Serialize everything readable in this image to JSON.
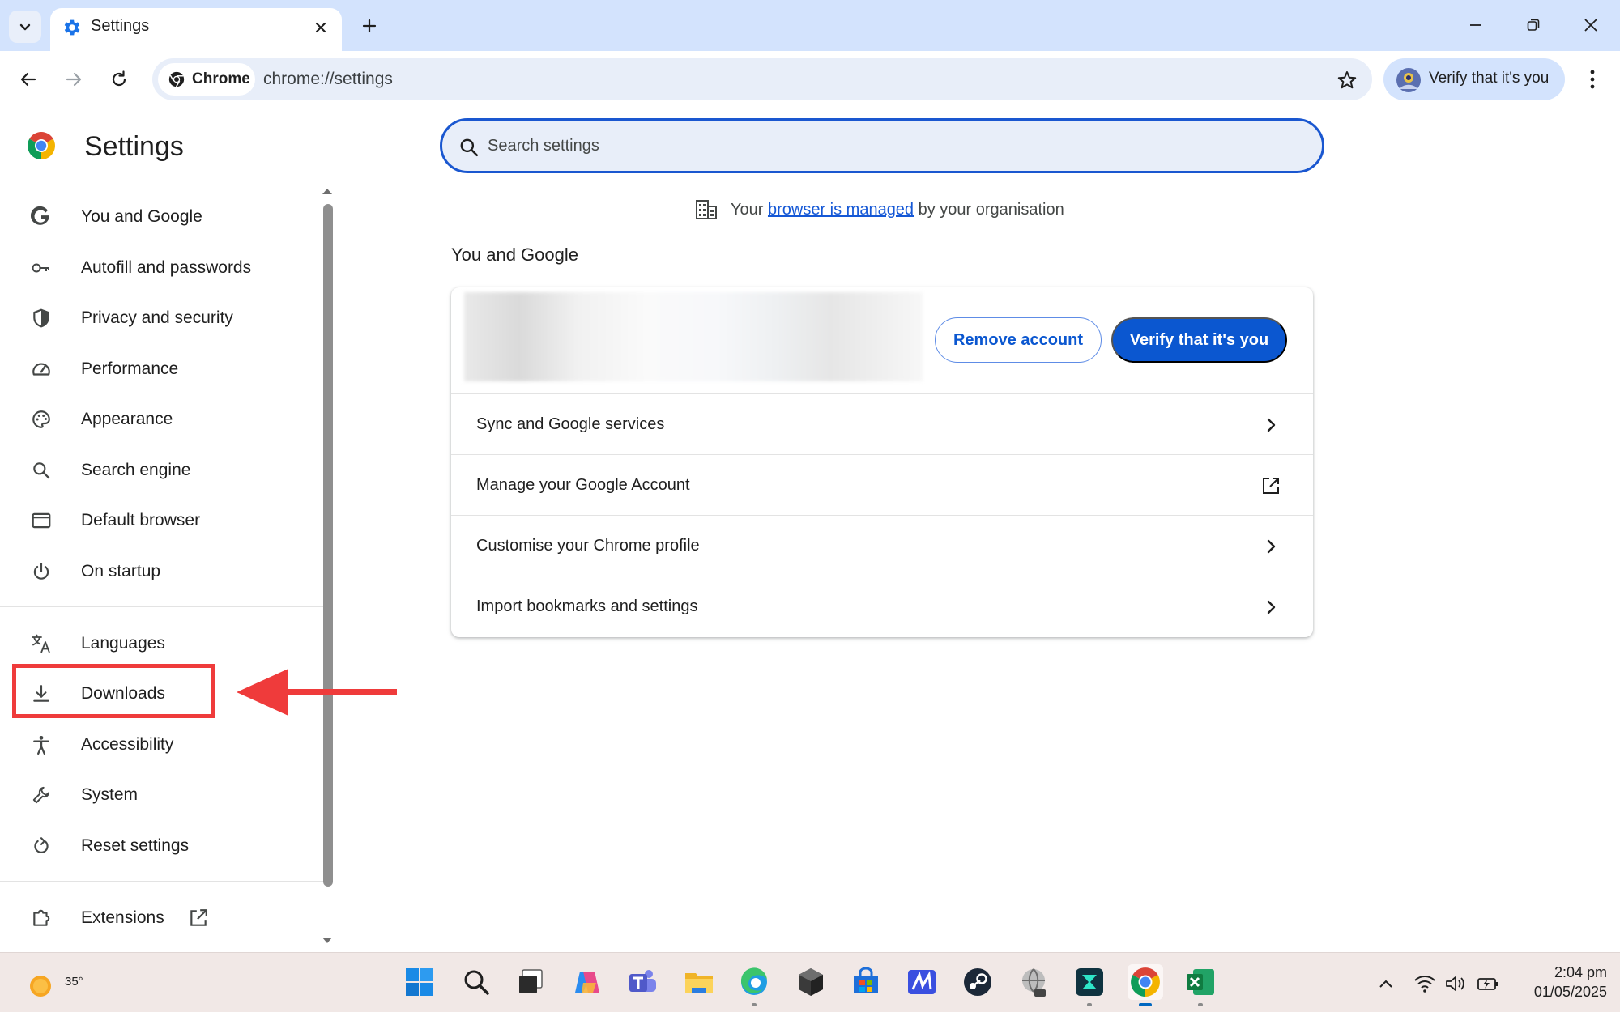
{
  "browser": {
    "tab": {
      "title": "Settings"
    },
    "omnibox": {
      "chip_label": "Chrome",
      "url": "chrome://settings"
    },
    "profile": {
      "label": "Verify that it's you"
    }
  },
  "sidebar": {
    "title": "Settings",
    "items": [
      {
        "label": "You and Google",
        "icon": "google-g-icon"
      },
      {
        "label": "Autofill and passwords",
        "icon": "key-icon"
      },
      {
        "label": "Privacy and security",
        "icon": "shield-icon"
      },
      {
        "label": "Performance",
        "icon": "speedometer-icon"
      },
      {
        "label": "Appearance",
        "icon": "palette-icon"
      },
      {
        "label": "Search engine",
        "icon": "search-icon"
      },
      {
        "label": "Default browser",
        "icon": "browser-window-icon"
      },
      {
        "label": "On startup",
        "icon": "power-icon"
      },
      {
        "label": "Languages",
        "icon": "translate-icon"
      },
      {
        "label": "Downloads",
        "icon": "download-icon"
      },
      {
        "label": "Accessibility",
        "icon": "accessibility-icon"
      },
      {
        "label": "System",
        "icon": "wrench-icon"
      },
      {
        "label": "Reset settings",
        "icon": "reset-icon"
      },
      {
        "label": "Extensions",
        "icon": "puzzle-icon"
      }
    ]
  },
  "main": {
    "search": {
      "placeholder": "Search settings"
    },
    "managed": {
      "prefix": "Your ",
      "link": "browser is managed",
      "suffix": " by your organisation"
    },
    "section_title": "You and Google",
    "account": {
      "remove_label": "Remove account",
      "verify_label": "Verify that it's you"
    },
    "rows": [
      {
        "label": "Sync and Google services",
        "icon": "chevron-right-icon"
      },
      {
        "label": "Manage your Google Account",
        "icon": "open-in-new-icon"
      },
      {
        "label": "Customise your Chrome profile",
        "icon": "chevron-right-icon"
      },
      {
        "label": "Import bookmarks and settings",
        "icon": "chevron-right-icon"
      }
    ]
  },
  "taskbar": {
    "weather_temp": "35°",
    "time": "2:04 pm",
    "date": "01/05/2025"
  },
  "colors": {
    "accent": "#0b57d0",
    "tabstrip": "#d3e3fd",
    "annotation_red": "#ef3b3b"
  }
}
